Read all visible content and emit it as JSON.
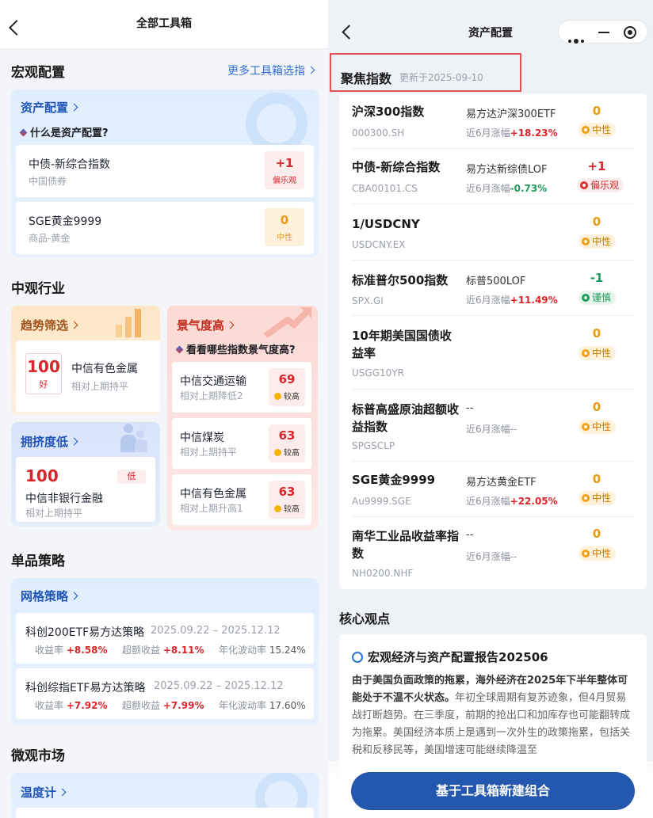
{
  "left": {
    "title": "全部工具箱",
    "macro": {
      "section": "宏观配置",
      "more": "更多工具箱选指",
      "asset_card": {
        "title": "资产配置",
        "question": "什么是资产配置?",
        "items": [
          {
            "name": "中债-新综合指数",
            "sub": "中国债券",
            "value": "+1",
            "label": "偏乐观"
          },
          {
            "name": "SGE黄金9999",
            "sub": "商品-黄金",
            "value": "0",
            "label": "中性"
          }
        ]
      }
    },
    "meso": {
      "section": "中观行业",
      "trend": {
        "title": "趋势筛选",
        "score": "100",
        "score_label": "好",
        "name": "中信有色金属",
        "sub": "相对上期持平"
      },
      "crowd": {
        "title": "拥挤度低",
        "score": "100",
        "tag": "低",
        "name": "中信非银行金融",
        "sub": "相对上期持平"
      },
      "hot": {
        "title": "景气度高",
        "question": "看看哪些指数景气度高?",
        "items": [
          {
            "name": "中信交通运输",
            "sub": "相对上期降低2",
            "value": "69",
            "label": "较高"
          },
          {
            "name": "中信煤炭",
            "sub": "相对上期持平",
            "value": "63",
            "label": "较高"
          },
          {
            "name": "中信有色金属",
            "sub": "相对上期升高1",
            "value": "63",
            "label": "较高"
          }
        ]
      }
    },
    "single": {
      "section": "单品策略",
      "grid": {
        "title": "网格策略",
        "items": [
          {
            "name": "科创200ETF易方达策略",
            "date": "2025.09.22 – 2025.12.12",
            "ret_label": "收益率",
            "ret": "+8.58%",
            "excess_label": "超额收益",
            "excess": "+8.11%",
            "vol_label": "年化波动率",
            "vol": "15.24%"
          },
          {
            "name": "科创综指ETF易方达策略",
            "date": "2025.09.22 – 2025.12.12",
            "ret_label": "收益率",
            "ret": "+7.92%",
            "excess_label": "超额收益",
            "excess": "+7.99%",
            "vol_label": "年化波动率",
            "vol": "17.60%"
          }
        ]
      }
    },
    "micro": {
      "section": "微观市场",
      "thermo": {
        "title": "温度计"
      }
    }
  },
  "right": {
    "title": "资产配置",
    "focus": {
      "title": "聚焦指数",
      "updated": "更新于2025-09-10"
    },
    "indices": [
      {
        "name": "沪深300指数",
        "code": "000300.SH",
        "fund": "易方达沪深300ETF",
        "chg_label": "近6月涨幅",
        "chg": "+18.23%",
        "dir": "up",
        "score": "0",
        "tag": "中性",
        "tone": "neu"
      },
      {
        "name": "中债-新综合指数",
        "code": "CBA00101.CS",
        "fund": "易方达新综债LOF",
        "chg_label": "近6月涨幅",
        "chg": "-0.73%",
        "dir": "dn",
        "score": "+1",
        "tag": "偏乐观",
        "tone": "opt"
      },
      {
        "name": "1/USDCNY",
        "code": "USDCNY.EX",
        "fund": "",
        "chg_label": "",
        "chg": "",
        "dir": "",
        "score": "0",
        "tag": "中性",
        "tone": "neu"
      },
      {
        "name": "标准普尔500指数",
        "code": "SPX.GI",
        "fund": "标普500LOF",
        "chg_label": "近6月涨幅",
        "chg": "+11.49%",
        "dir": "up",
        "score": "-1",
        "tag": "谨慎",
        "tone": "cau"
      },
      {
        "name": "10年期美国国债收益率",
        "code": "USGG10YR",
        "fund": "",
        "chg_label": "",
        "chg": "",
        "dir": "",
        "score": "0",
        "tag": "中性",
        "tone": "neu"
      },
      {
        "name": "标普高盛原油超额收益指数",
        "code": "SPGSCLP",
        "fund": "--",
        "chg_label": "近6月涨幅",
        "chg": "--",
        "dir": "",
        "score": "0",
        "tag": "中性",
        "tone": "neu"
      },
      {
        "name": "SGE黄金9999",
        "code": "Au9999.SGE",
        "fund": "易方达黄金ETF",
        "chg_label": "近6月涨幅",
        "chg": "+22.05%",
        "dir": "up",
        "score": "0",
        "tag": "中性",
        "tone": "neu"
      },
      {
        "name": "南华工业品收益率指数",
        "code": "NH0200.NHF",
        "fund": "--",
        "chg_label": "近6月涨幅",
        "chg": "--",
        "dir": "",
        "score": "0",
        "tag": "中性",
        "tone": "neu"
      }
    ],
    "core": {
      "section": "核心观点",
      "report_title": "宏观经济与资产配置报告202506",
      "lead": "由于美国负面政策的拖累，海外经济在2025年下半年整体可能处于不温不火状态。",
      "body": "年初全球周期有复苏迹象，但4月贸易战打断趋势。在三季度，前期的抢出口和加库存也可能翻转成为拖累。美国经济本质上是遇到一次外生的政策拖累，包括关税和反移民等，美国增速可能继续降温至"
    },
    "cta": "基于工具箱新建组合"
  },
  "colors": {
    "accent": "#2457ae",
    "up": "#d9262b",
    "down": "#1d9a5a",
    "neutral": "#f0a010",
    "highlight_box": "#e05252"
  }
}
